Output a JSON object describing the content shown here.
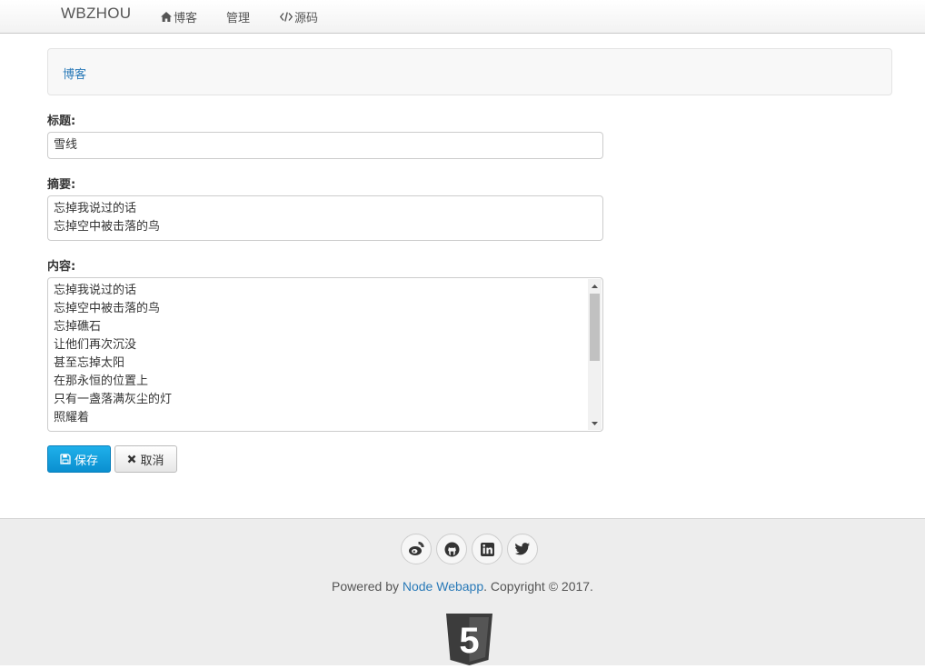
{
  "navbar": {
    "brand": "WBZHOU",
    "links": [
      {
        "label": "博客",
        "icon": "home-icon"
      },
      {
        "label": "管理"
      },
      {
        "label": "源码",
        "icon": "code-icon"
      }
    ]
  },
  "breadcrumb": {
    "label": "博客"
  },
  "form": {
    "title_label": "标题:",
    "title_value": "雪线",
    "summary_label": "摘要:",
    "summary_lines": [
      "忘掉我说过的话",
      "忘掉空中被击落的鸟"
    ],
    "content_label": "内容:",
    "content_lines": [
      "忘掉我说过的话",
      "忘掉空中被击落的鸟",
      "忘掉礁石",
      "让他们再次沉没",
      "甚至忘掉太阳",
      "在那永恒的位置上",
      "只有一盏落满灰尘的灯",
      "照耀着"
    ],
    "save_label": "保存",
    "cancel_label": "取消"
  },
  "footer": {
    "social_icons": [
      "weibo-icon",
      "github-icon",
      "linkedin-icon",
      "twitter-icon"
    ],
    "powered_prefix": "Powered by ",
    "powered_link": "Node Webapp",
    "powered_suffix": ". Copyright © 2017.",
    "logo_text": "5"
  },
  "colors": {
    "primary": "#0a8fd0",
    "link": "#2a7ab8",
    "footer_bg": "#ededed"
  }
}
